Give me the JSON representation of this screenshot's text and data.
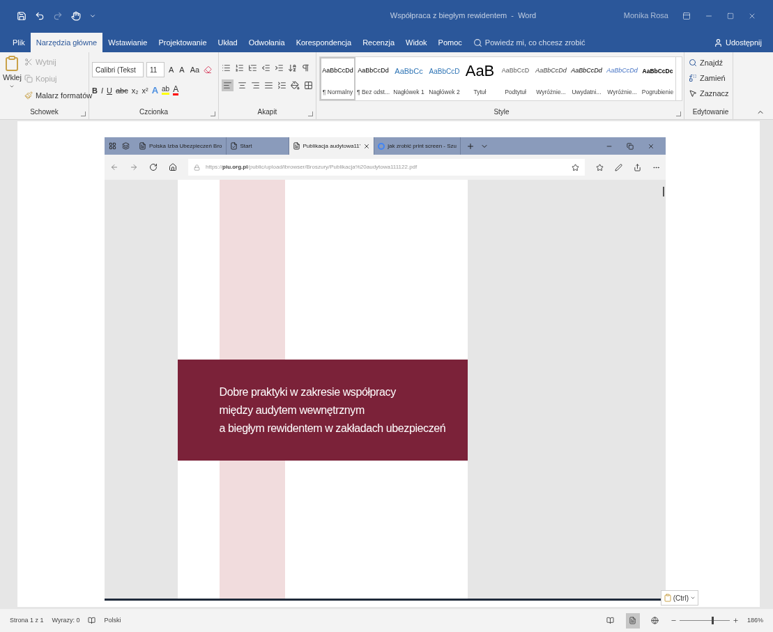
{
  "window": {
    "title": "Współpraca z biegłym rewidentem  -  Word",
    "user": "Monika Rosa"
  },
  "ribbon_tabs": [
    {
      "label": "Plik",
      "selected": false
    },
    {
      "label": "Narzędzia główne",
      "selected": true
    },
    {
      "label": "Wstawianie",
      "selected": false
    },
    {
      "label": "Projektowanie",
      "selected": false
    },
    {
      "label": "Układ",
      "selected": false
    },
    {
      "label": "Odwołania",
      "selected": false
    },
    {
      "label": "Korespondencja",
      "selected": false
    },
    {
      "label": "Recenzja",
      "selected": false
    },
    {
      "label": "Widok",
      "selected": false
    },
    {
      "label": "Pomoc",
      "selected": false
    }
  ],
  "tell_me": {
    "placeholder": "Powiedz mi, co chcesz zrobić"
  },
  "share": "Udostępnij",
  "clipboard": {
    "paste": "Wklej",
    "items": [
      {
        "label": "Wytnij",
        "disabled": true
      },
      {
        "label": "Kopiuj",
        "disabled": true
      },
      {
        "label": "Malarz formatów",
        "disabled": false
      }
    ],
    "group": "Schowek"
  },
  "font": {
    "name": "Calibri (Tekst",
    "size": "11",
    "row1": [
      "A",
      "A",
      "Aa"
    ],
    "row2": [
      "B",
      "I",
      "U",
      "abc",
      "x₂",
      "x²"
    ],
    "effect": "A",
    "highlight": "ab",
    "color_letter": "A",
    "group": "Czcionka"
  },
  "paragraph": {
    "group": "Akapit"
  },
  "styles": {
    "group": "Style",
    "items": [
      {
        "preview": "AaBbCcDd",
        "label": "¶ Normalny",
        "kind": "normal",
        "selected": true
      },
      {
        "preview": "AaBbCcDd",
        "label": "¶ Bez odst...",
        "kind": "normal",
        "selected": false
      },
      {
        "preview": "AaBbCc",
        "label": "Nagłówek 1",
        "kind": "heading1",
        "selected": false
      },
      {
        "preview": "AaBbCcD",
        "label": "Nagłówek 2",
        "kind": "heading2",
        "selected": false
      },
      {
        "preview": "AaB",
        "label": "Tytuł",
        "kind": "title",
        "selected": false
      },
      {
        "preview": "AaBbCcD",
        "label": "Podtytuł",
        "kind": "subtitle",
        "selected": false
      },
      {
        "preview": "AaBbCcDd",
        "label": "Wyróżnie...",
        "kind": "subtle",
        "selected": false
      },
      {
        "preview": "AaBbCcDd",
        "label": "Uwydatni...",
        "kind": "emphasis",
        "selected": false
      },
      {
        "preview": "AaBbCcDd",
        "label": "Wyróżnie...",
        "kind": "intense",
        "selected": false
      },
      {
        "preview": "AaBbCcDc",
        "label": "Pogrubienie",
        "kind": "strong",
        "selected": false
      }
    ]
  },
  "editing": {
    "group": "Edytowanie",
    "items": [
      {
        "label": "Znajdź",
        "kind": "find"
      },
      {
        "label": "Zamień",
        "kind": "replace"
      },
      {
        "label": "Zaznacz",
        "kind": "select"
      }
    ]
  },
  "browser": {
    "tabs": [
      {
        "title": "Polska Izba Ubezpieczeń Bro",
        "kind": "page",
        "selected": false
      },
      {
        "title": "Start",
        "kind": "start",
        "selected": false
      },
      {
        "title": "Publikacja audytowa11'",
        "kind": "page",
        "selected": true
      },
      {
        "title": "jak zrobić print screen - Szu",
        "kind": "search",
        "selected": false
      }
    ],
    "url": "https://**piu.org.pl**/public/upload/ibrowser/Broszury/Publikacja%20audytowa111122.pdf",
    "pdf_title": [
      "Dobre praktyki w zakresie współpracy",
      "między audytem wewnętrznym",
      "a biegłym rewidentem w zakładach ubezpieczeń"
    ]
  },
  "paste_options": "(Ctrl)",
  "status_bar": {
    "page": "Strona 1 z 1",
    "words": "Wyrazy: 0",
    "language": "Polski",
    "views": [
      {
        "kind": "read",
        "selected": false
      },
      {
        "kind": "print",
        "selected": true
      },
      {
        "kind": "web",
        "selected": false
      }
    ],
    "zoom": {
      "level": 0.67,
      "reading": "186%"
    }
  }
}
